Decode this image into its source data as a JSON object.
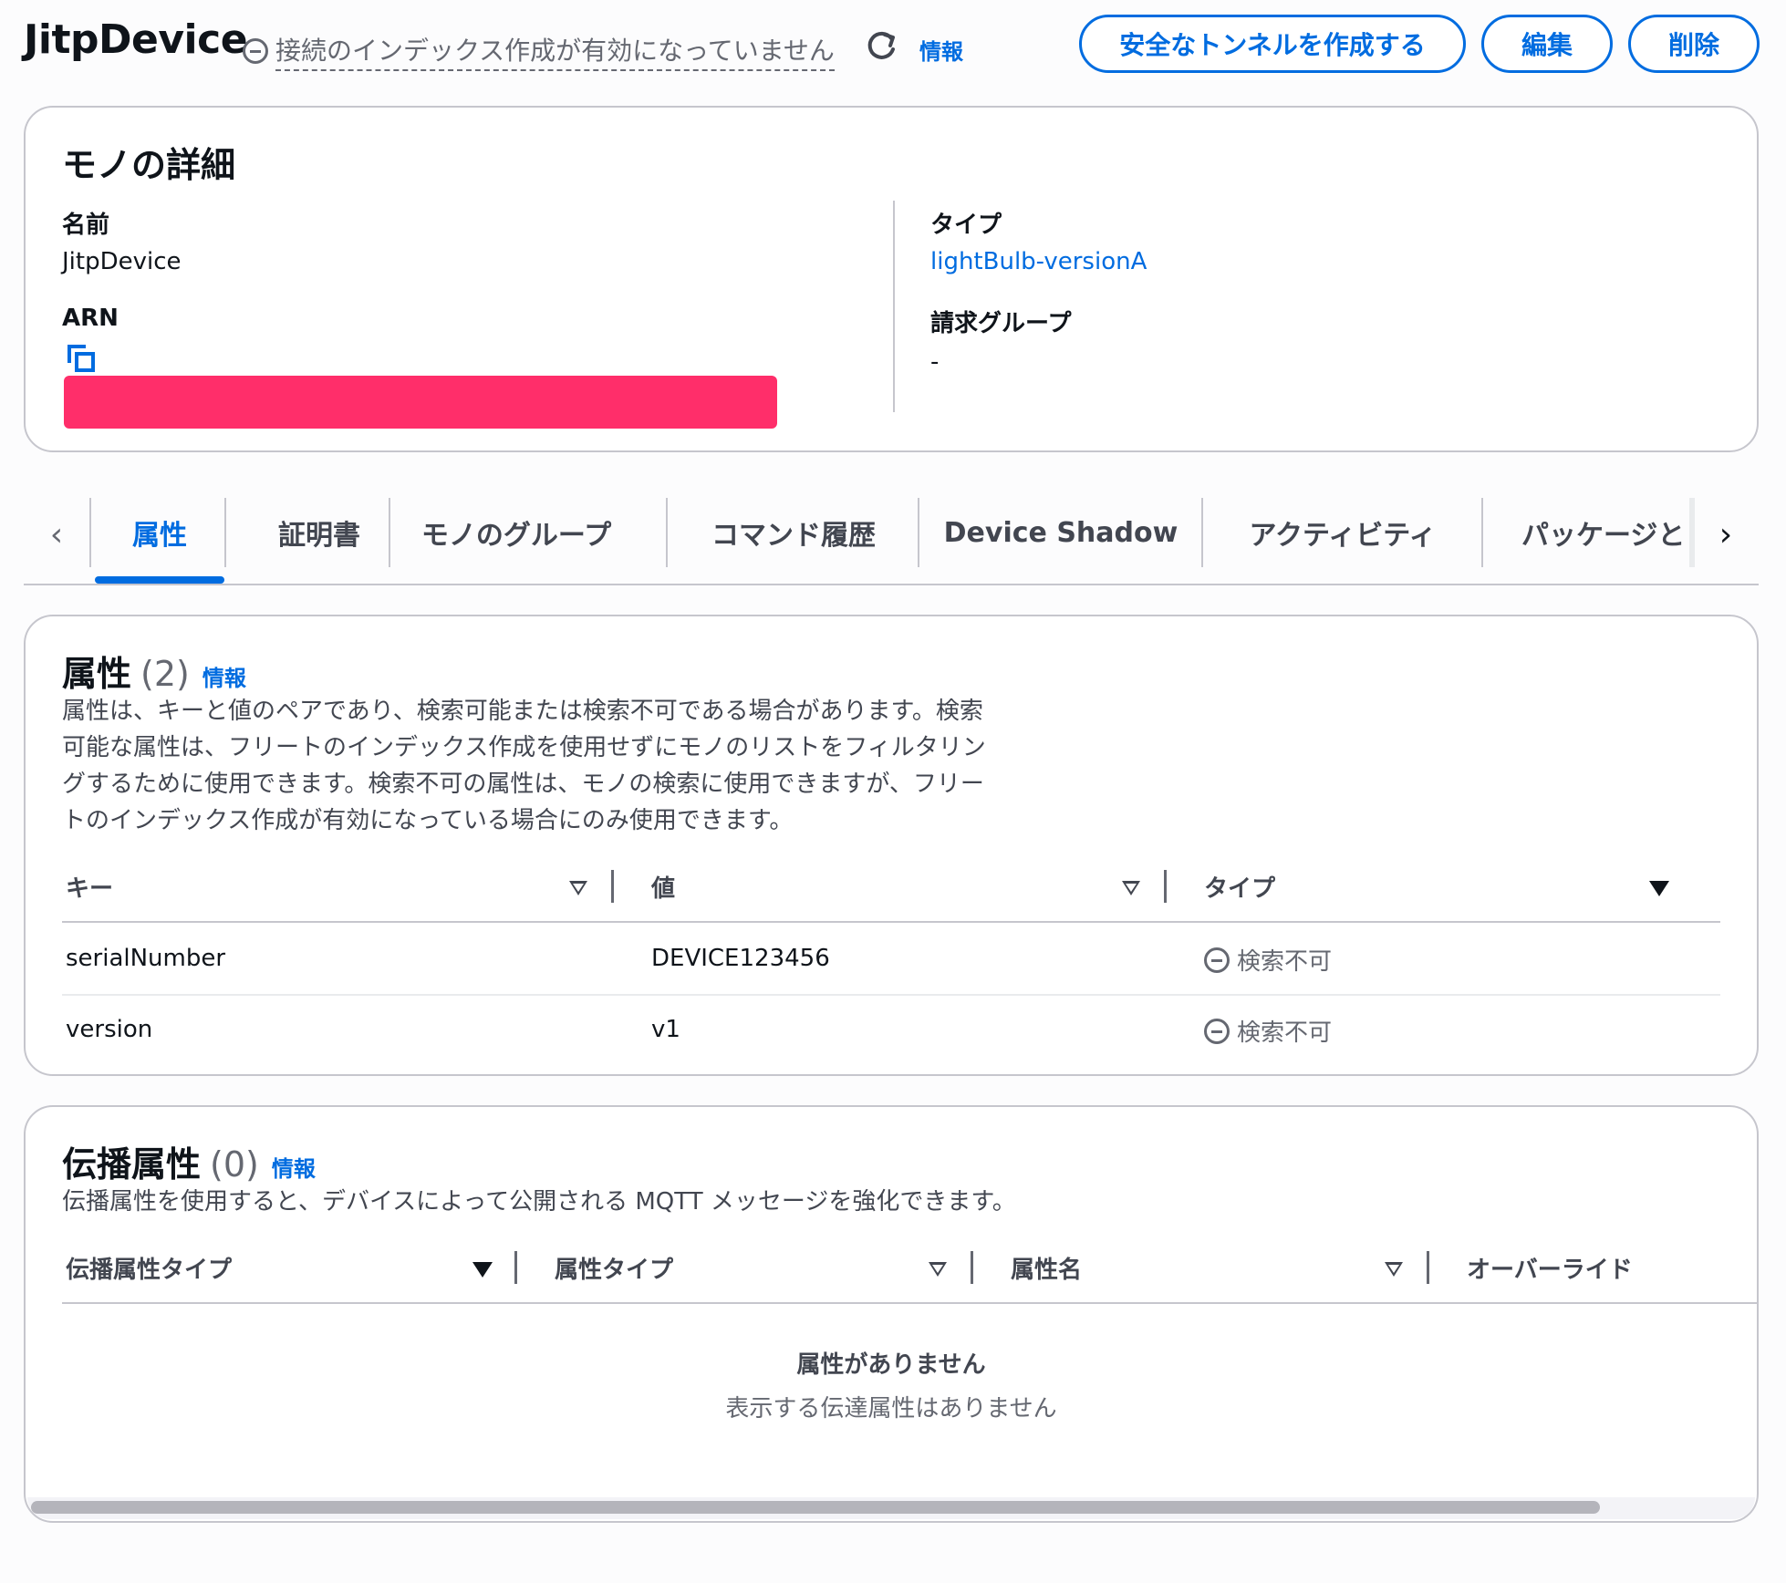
{
  "header": {
    "title": "JitpDevice",
    "status": "接続のインデックス作成が有効になっていません",
    "info": "情報",
    "buttons": {
      "tunnel": "安全なトンネルを作成する",
      "edit": "編集",
      "delete": "削除"
    }
  },
  "details": {
    "title": "モノの詳細",
    "name_label": "名前",
    "name_value": "JitpDevice",
    "arn_label": "ARN",
    "type_label": "タイプ",
    "type_value": "lightBulb-versionA",
    "billing_label": "請求グループ",
    "billing_value": "-"
  },
  "tabs": {
    "items": [
      "属性",
      "証明書",
      "モノのグループ",
      "コマンド履歴",
      "Device Shadow",
      "アクティビティ",
      "パッケージと"
    ],
    "active": "属性"
  },
  "attributes": {
    "title": "属性",
    "count": "(2)",
    "info": "情報",
    "description_lines": [
      "属性は、キーと値のペアであり、検索可能または検索不可である場合があります。検索",
      "可能な属性は、フリートのインデックス作成を使用せずにモノのリストをフィルタリン",
      "グするために使用できます。検索不可の属性は、モノの検索に使用できますが、フリー",
      "トのインデックス作成が有効になっている場合にのみ使用できます。"
    ],
    "columns": [
      "キー",
      "値",
      "タイプ"
    ],
    "rows": [
      {
        "key": "serialNumber",
        "value": "DEVICE123456",
        "type": "検索不可"
      },
      {
        "key": "version",
        "value": "v1",
        "type": "検索不可"
      }
    ]
  },
  "propagating": {
    "title": "伝播属性",
    "count": "(0)",
    "info": "情報",
    "description": "伝播属性を使用すると、デバイスによって公開される MQTT メッセージを強化できます。",
    "columns": [
      "伝播属性タイプ",
      "属性タイプ",
      "属性名",
      "オーバーライド"
    ],
    "empty_title": "属性がありません",
    "empty_sub": "表示する伝達属性はありません"
  },
  "colors": {
    "accent": "#006ce0",
    "redaction": "#ff2e6a",
    "border": "#c6c6cd",
    "muted_text": "#656871"
  }
}
